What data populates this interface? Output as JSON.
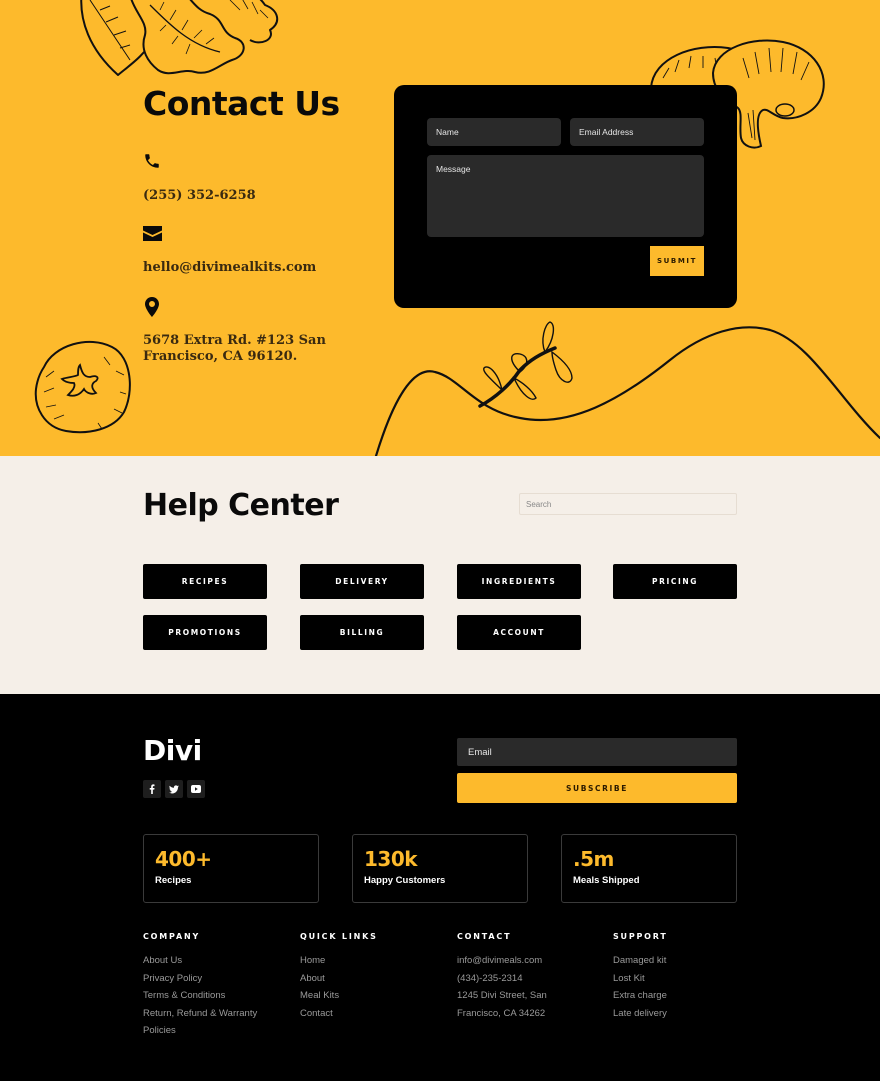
{
  "theme": {
    "accent": "#FDBA2C",
    "cream": "#F5EFE8",
    "dark": "#000000",
    "field_bg": "#2A2A2A"
  },
  "contact": {
    "title": "Contact Us",
    "items": [
      {
        "icon": "phone-icon",
        "text": "(255) 352-6258"
      },
      {
        "icon": "envelope-icon",
        "text": "hello@divimealkits.com"
      },
      {
        "icon": "map-pin-icon",
        "text": "5678 Extra Rd. #123 San Francisco, CA 96120."
      }
    ],
    "form": {
      "name_placeholder": "Name",
      "email_placeholder": "Email Address",
      "message_placeholder": "Message",
      "submit_label": "SUBMIT"
    },
    "decorations": [
      "oak-leaves-illustration",
      "mushrooms-illustration",
      "tomato-illustration",
      "hill-line-with-sprout"
    ]
  },
  "help_center": {
    "title": "Help Center",
    "search_placeholder": "Search",
    "buttons": [
      "RECIPES",
      "DELIVERY",
      "INGREDIENTS",
      "PRICING",
      "PROMOTIONS",
      "BILLING",
      "ACCOUNT"
    ]
  },
  "footer": {
    "logo": "Divi",
    "social": [
      {
        "name": "facebook-icon",
        "glyph": "f"
      },
      {
        "name": "twitter-icon",
        "glyph": "t"
      },
      {
        "name": "youtube-icon",
        "glyph": "y"
      }
    ],
    "newsletter": {
      "email_placeholder": "Email",
      "subscribe_label": "SUBSCRIBE"
    },
    "stats": [
      {
        "value": "400+",
        "label": "Recipes"
      },
      {
        "value": "130k",
        "label": "Happy Customers"
      },
      {
        "value": ".5m",
        "label": "Meals Shipped"
      }
    ],
    "columns": [
      {
        "heading": "COMPANY",
        "links": [
          "About Us",
          "Privacy Policy",
          "Terms & Conditions",
          "Return, Refund & Warranty",
          "Policies"
        ]
      },
      {
        "heading": "QUICK LINKS",
        "links": [
          "Home",
          "About",
          "Meal Kits",
          "Contact"
        ]
      },
      {
        "heading": "CONTACT",
        "links": [
          "info@divimeals.com",
          "(434)-235-2314",
          "1245 Divi Street, San",
          "Francisco, CA 34262"
        ]
      },
      {
        "heading": "SUPPORT",
        "links": [
          "Damaged kit",
          "Lost Kit",
          "Extra charge",
          "Late delivery"
        ]
      }
    ]
  }
}
